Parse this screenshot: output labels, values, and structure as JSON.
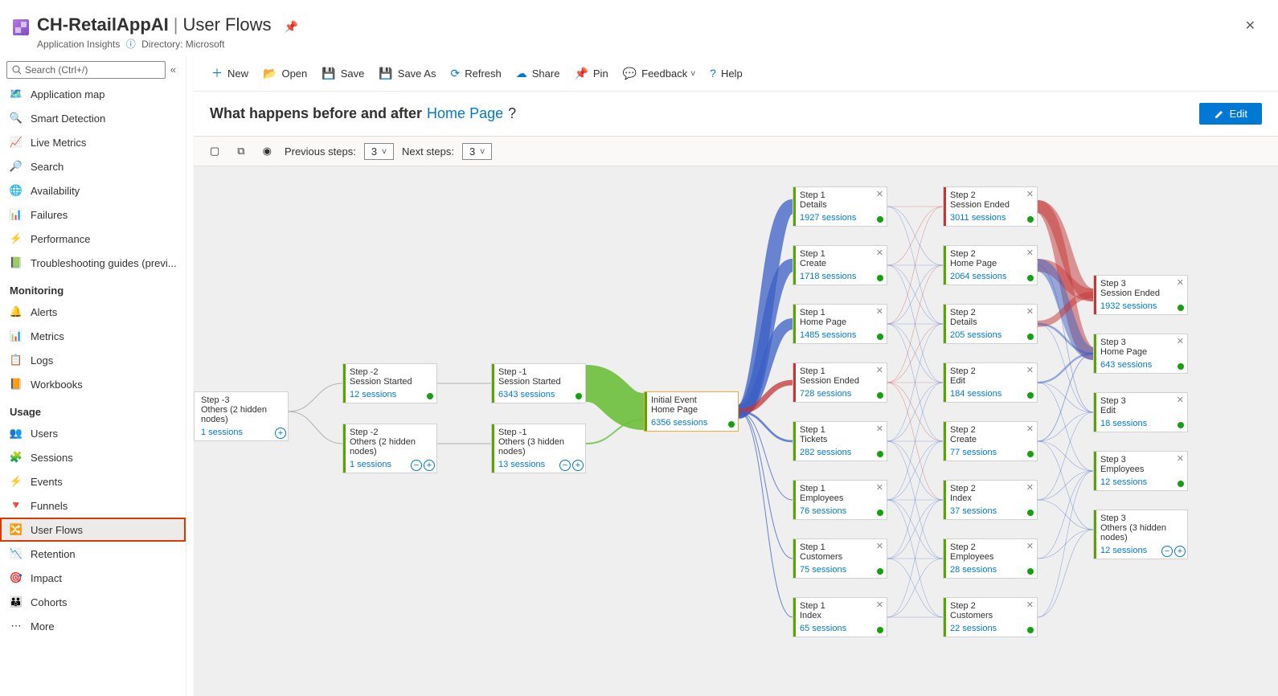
{
  "header": {
    "app_name": "CH-RetailAppAI",
    "page_name": "User Flows",
    "service": "Application Insights",
    "directory_label": "Directory: Microsoft"
  },
  "search_placeholder": "Search (Ctrl+/)",
  "sidebar": {
    "items": [
      {
        "label": "Application map",
        "icon": "🗺️"
      },
      {
        "label": "Smart Detection",
        "icon": "🔍"
      },
      {
        "label": "Live Metrics",
        "icon": "📈"
      },
      {
        "label": "Search",
        "icon": "🔎"
      },
      {
        "label": "Availability",
        "icon": "🌐"
      },
      {
        "label": "Failures",
        "icon": "📊"
      },
      {
        "label": "Performance",
        "icon": "⚡"
      },
      {
        "label": "Troubleshooting guides (previ...",
        "icon": "📗"
      }
    ],
    "group_monitoring": "Monitoring",
    "monitoring": [
      {
        "label": "Alerts",
        "icon": "🔔"
      },
      {
        "label": "Metrics",
        "icon": "📊"
      },
      {
        "label": "Logs",
        "icon": "📋"
      },
      {
        "label": "Workbooks",
        "icon": "📙"
      }
    ],
    "group_usage": "Usage",
    "usage": [
      {
        "label": "Users",
        "icon": "👥"
      },
      {
        "label": "Sessions",
        "icon": "🧩"
      },
      {
        "label": "Events",
        "icon": "⚡"
      },
      {
        "label": "Funnels",
        "icon": "🔻"
      },
      {
        "label": "User Flows",
        "icon": "🔀",
        "selected": true,
        "highlight": true
      },
      {
        "label": "Retention",
        "icon": "📉"
      },
      {
        "label": "Impact",
        "icon": "🎯"
      },
      {
        "label": "Cohorts",
        "icon": "👪"
      },
      {
        "label": "More",
        "icon": "⋯"
      }
    ]
  },
  "toolbar": {
    "new": "New",
    "open": "Open",
    "save": "Save",
    "saveas": "Save As",
    "refresh": "Refresh",
    "share": "Share",
    "pin": "Pin",
    "feedback": "Feedback",
    "help": "Help"
  },
  "question": {
    "prefix": "What happens before and after",
    "link": "Home Page",
    "suffix": "?"
  },
  "edit_label": "Edit",
  "flow_controls": {
    "prev_label": "Previous steps:",
    "prev_value": "3",
    "next_label": "Next steps:",
    "next_value": "3"
  },
  "nodes": {
    "m3": {
      "step": "Step -3",
      "name": "Others (2 hidden nodes)",
      "sess": "1 sessions"
    },
    "m2a": {
      "step": "Step -2",
      "name": "Session Started",
      "sess": "12 sessions"
    },
    "m2b": {
      "step": "Step -2",
      "name": "Others (2 hidden nodes)",
      "sess": "1 sessions"
    },
    "m1a": {
      "step": "Step -1",
      "name": "Session Started",
      "sess": "6343 sessions"
    },
    "m1b": {
      "step": "Step -1",
      "name": "Others (3 hidden nodes)",
      "sess": "13 sessions"
    },
    "ev": {
      "step": "Initial Event",
      "name": "Home Page",
      "sess": "6356 sessions"
    },
    "s1_1": {
      "step": "Step 1",
      "name": "Details",
      "sess": "1927 sessions"
    },
    "s1_2": {
      "step": "Step 1",
      "name": "Create",
      "sess": "1718 sessions"
    },
    "s1_3": {
      "step": "Step 1",
      "name": "Home Page",
      "sess": "1485 sessions"
    },
    "s1_4": {
      "step": "Step 1",
      "name": "Session Ended",
      "sess": "728 sessions",
      "red": true
    },
    "s1_5": {
      "step": "Step 1",
      "name": "Tickets",
      "sess": "282 sessions"
    },
    "s1_6": {
      "step": "Step 1",
      "name": "Employees",
      "sess": "76 sessions"
    },
    "s1_7": {
      "step": "Step 1",
      "name": "Customers",
      "sess": "75 sessions"
    },
    "s1_8": {
      "step": "Step 1",
      "name": "Index",
      "sess": "65 sessions"
    },
    "s2_1": {
      "step": "Step 2",
      "name": "Session Ended",
      "sess": "3011 sessions",
      "red": true
    },
    "s2_2": {
      "step": "Step 2",
      "name": "Home Page",
      "sess": "2064 sessions"
    },
    "s2_3": {
      "step": "Step 2",
      "name": "Details",
      "sess": "205 sessions"
    },
    "s2_4": {
      "step": "Step 2",
      "name": "Edit",
      "sess": "184 sessions"
    },
    "s2_5": {
      "step": "Step 2",
      "name": "Create",
      "sess": "77 sessions"
    },
    "s2_6": {
      "step": "Step 2",
      "name": "Index",
      "sess": "37 sessions"
    },
    "s2_7": {
      "step": "Step 2",
      "name": "Employees",
      "sess": "28 sessions"
    },
    "s2_8": {
      "step": "Step 2",
      "name": "Customers",
      "sess": "22 sessions"
    },
    "s3_1": {
      "step": "Step 3",
      "name": "Session Ended",
      "sess": "1932 sessions",
      "red": true
    },
    "s3_2": {
      "step": "Step 3",
      "name": "Home Page",
      "sess": "643 sessions"
    },
    "s3_3": {
      "step": "Step 3",
      "name": "Edit",
      "sess": "18 sessions"
    },
    "s3_4": {
      "step": "Step 3",
      "name": "Employees",
      "sess": "12 sessions"
    },
    "s3_5": {
      "step": "Step 3",
      "name": "Others (3 hidden nodes)",
      "sess": "12 sessions"
    }
  }
}
